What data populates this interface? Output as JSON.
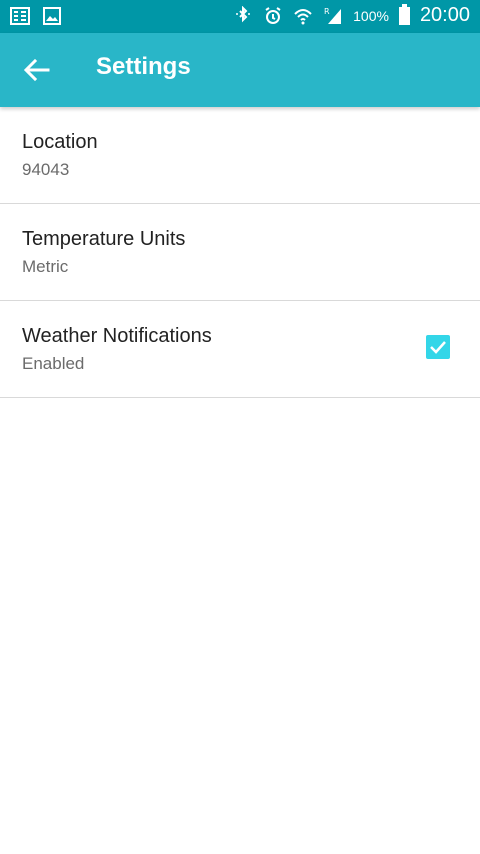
{
  "status_bar": {
    "battery": "100%",
    "time": "20:00",
    "icons": [
      "notification-icon",
      "image-icon",
      "bluetooth-icon",
      "alarm-icon",
      "wifi-icon",
      "signal-icon",
      "battery-icon"
    ]
  },
  "app_bar": {
    "title": "Settings",
    "back_icon": "arrow-back-icon"
  },
  "settings": [
    {
      "title": "Location",
      "summary": "94043"
    },
    {
      "title": "Temperature Units",
      "summary": "Metric"
    },
    {
      "title": "Weather Notifications",
      "summary": "Enabled",
      "checked": true
    }
  ],
  "colors": {
    "status_bar": "#0097a7",
    "app_bar": "#29b6c8",
    "checkbox": "#33d6e8"
  }
}
